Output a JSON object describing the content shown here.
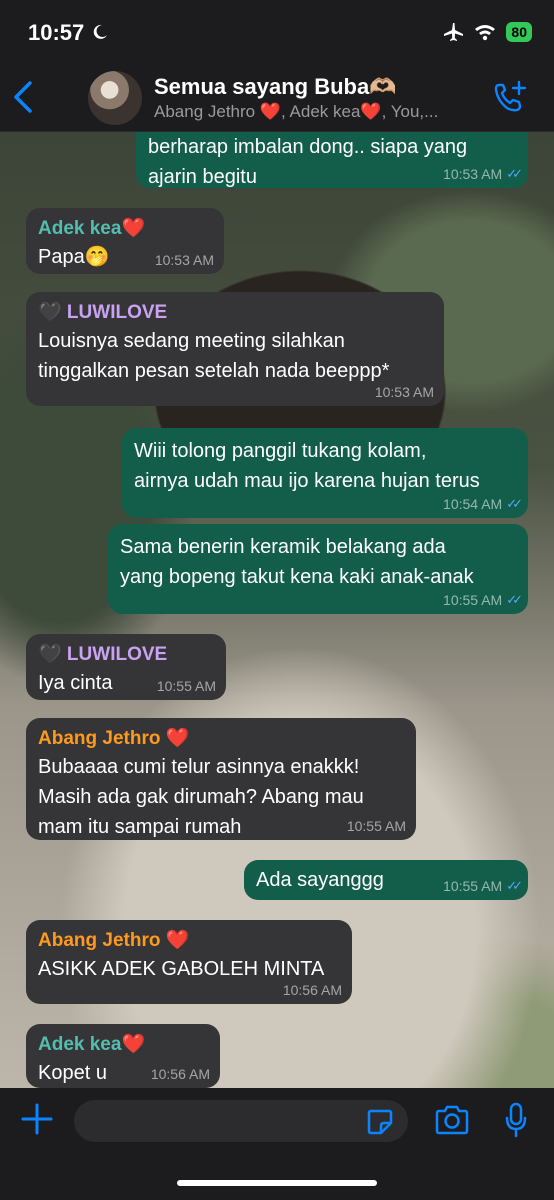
{
  "status": {
    "time": "10:57",
    "battery": "80"
  },
  "header": {
    "title": "Semua sayang Buba🫶🏼",
    "subtitle": "Abang Jethro ❤️, Adek kea❤️, You,..."
  },
  "messages": [
    {
      "dir": "out",
      "text": "berharap imbalan dong..  siapa yang\najarin begitu",
      "time": "10:53 AM"
    },
    {
      "dir": "in",
      "sender": "Adek kea❤️",
      "text": "Papa🤭",
      "time": "10:53 AM"
    },
    {
      "dir": "in",
      "sender": "🖤 LUWILOVE",
      "text": "Louisnya sedang meeting silahkan\ntinggalkan pesan setelah nada beeppp*",
      "time": "10:53 AM"
    },
    {
      "dir": "out",
      "text": "Wiii tolong panggil tukang kolam,\nairnya udah mau ijo karena hujan terus",
      "time": "10:54 AM"
    },
    {
      "dir": "out",
      "text": "Sama benerin keramik belakang ada\nyang bopeng takut kena kaki anak-anak",
      "time": "10:55 AM"
    },
    {
      "dir": "in",
      "sender": "🖤 LUWILOVE",
      "text": "Iya cinta",
      "time": "10:55 AM"
    },
    {
      "dir": "in",
      "sender": "Abang Jethro ❤️",
      "text": "Bubaaaa cumi telur asinnya enakkk!\nMasih ada gak dirumah? Abang mau\nmam itu sampai rumah",
      "time": "10:55 AM"
    },
    {
      "dir": "out",
      "text": "Ada sayanggg",
      "time": "10:55 AM"
    },
    {
      "dir": "in",
      "sender": "Abang Jethro ❤️",
      "text": "ASIKK ADEK GABOLEH MINTA",
      "time": "10:56 AM"
    },
    {
      "dir": "in",
      "sender": "Adek kea❤️",
      "text": "Kopet u",
      "time": "10:56 AM"
    }
  ],
  "icons": {
    "back": "chevron-left-icon",
    "call": "add-call-icon",
    "plus": "plus-icon",
    "sticker": "sticker-icon",
    "camera": "camera-icon",
    "mic": "microphone-icon"
  },
  "colors": {
    "accent": "#0a84ff",
    "outgoing": "#135e4b",
    "incoming": "#353538",
    "read_ticks": "#53a6ff"
  }
}
